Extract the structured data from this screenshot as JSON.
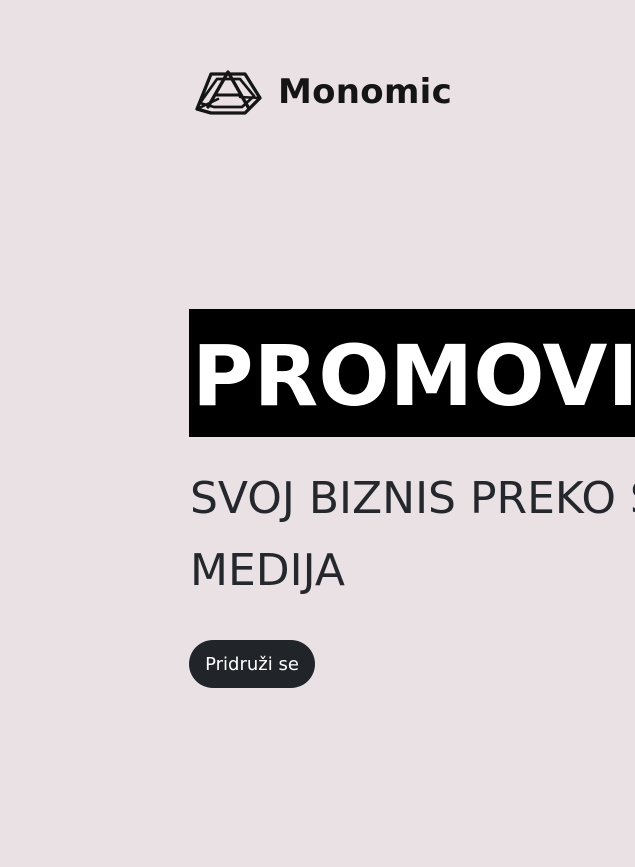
{
  "brand": {
    "name": "Monomic",
    "logo_icon": "monomic-triangle-logo-icon"
  },
  "hero": {
    "headline": "PROMOVI",
    "subheadline_lines": [
      "SVOJ BIZNIS PREKO S",
      "MEDIJA"
    ],
    "cta_label": "Pridruži se"
  },
  "colors": {
    "background": "#e9e1e4",
    "headline_background": "#000000",
    "headline_text": "#ffffff",
    "body_text": "#24272c",
    "button_background": "#212529",
    "button_text": "#ffffff"
  }
}
